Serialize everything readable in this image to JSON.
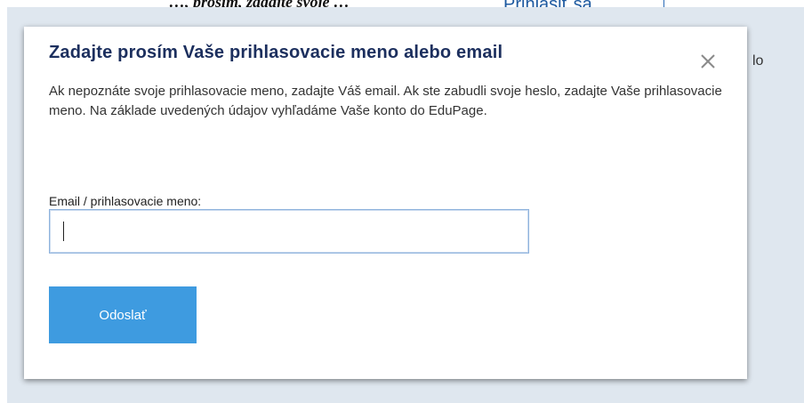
{
  "background": {
    "top_text": "…, prosím, zadajte svoje …",
    "login_link": "Prihlásiť sa",
    "right_text": "lo"
  },
  "modal": {
    "title": "Zadajte prosím Vaše prihlasovacie meno alebo email",
    "description": "Ak nepoznáte svoje prihlasovacie meno, zadajte Váš email. Ak ste zabudli svoje heslo, zadajte Vaše prihlasovacie meno. Na základe uvedených údajov vyhľadáme Vaše konto do EduPage.",
    "field_label": "Email / prihlasovacie meno:",
    "field_value": "",
    "field_placeholder": "",
    "submit_label": "Odoslať",
    "close_icon": "close-icon"
  },
  "colors": {
    "title": "#1c2f5e",
    "button": "#3e9be0",
    "input_border": "#8fb3dd",
    "overlay": "#dfe7ef"
  }
}
